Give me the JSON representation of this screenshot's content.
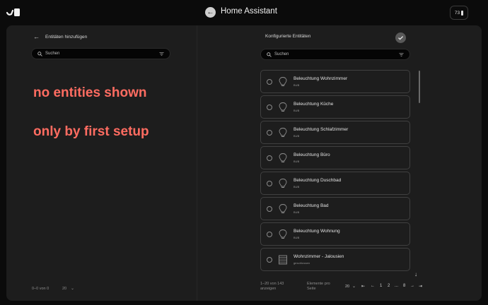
{
  "topbar": {
    "app_title": "Home Assistant",
    "battery_level": "73",
    "back_icon": "arrow-left-icon",
    "logo_icon": "brand-logo-icon"
  },
  "left": {
    "title": "Entitäten hinzufügen",
    "search_placeholder": "Suchen",
    "footer_count": "0–0 von 0",
    "footer_per_page": "20"
  },
  "annotation": {
    "line1": "no entities shown",
    "line2": "only by first setup"
  },
  "right": {
    "title": "Konfigurierte Entitäten",
    "search_placeholder": "Suchen",
    "items": [
      {
        "name": "Beleuchtung Wohnzimmer",
        "sub": "BUB",
        "icon": "lightbulb-icon"
      },
      {
        "name": "Beleuchtung Küche",
        "sub": "BUB",
        "icon": "lightbulb-icon"
      },
      {
        "name": "Beleuchtung Schlafzimmer",
        "sub": "BUB",
        "icon": "lightbulb-icon"
      },
      {
        "name": "Beleuchtung Büro",
        "sub": "BUB",
        "icon": "lightbulb-icon"
      },
      {
        "name": "Beleuchtung Duschbad",
        "sub": "BUB",
        "icon": "lightbulb-icon"
      },
      {
        "name": "Beleuchtung Bad",
        "sub": "BUB",
        "icon": "lightbulb-icon"
      },
      {
        "name": "Beleuchtung Wohnung",
        "sub": "BUB",
        "icon": "lightbulb-icon"
      },
      {
        "name": "Wohnzimmer - Jalousien",
        "sub": "geschlossen",
        "icon": "blinds-icon"
      }
    ],
    "pagination": {
      "count_text": "1–20 von 143 anzeigen",
      "per_page_label": "Elemente pro Seite",
      "per_page_value": "20",
      "first": "⇤",
      "prev": "←",
      "page1": "1",
      "page2": "2",
      "ellipsis": "...",
      "page_last": "8",
      "next": "→",
      "last": "⇥"
    }
  },
  "colors": {
    "background": "#0b0b0b",
    "panel": "#1d1d1d",
    "annotation": "#ff6c61"
  }
}
